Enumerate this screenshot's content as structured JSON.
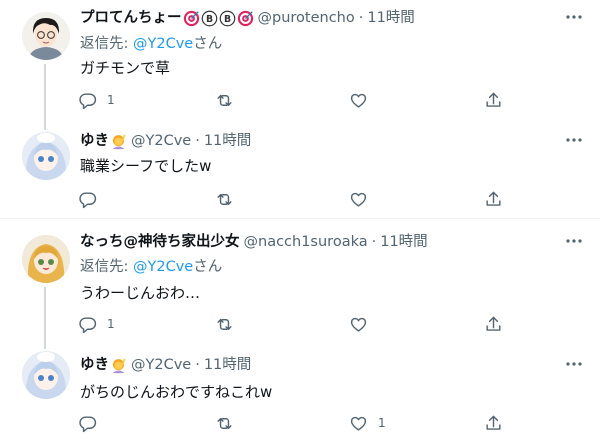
{
  "tweets": [
    {
      "name": "プロてんちょー",
      "handle": "@purotencho",
      "time": "11時間",
      "reply_prefix": "返信先: ",
      "reply_mention": "@Y2Cve",
      "reply_suffix": "さん",
      "text": "ガチモンで草",
      "replies": "1",
      "retweets": "",
      "likes": ""
    },
    {
      "name": "ゆき",
      "handle": "@Y2Cve",
      "time": "11時間",
      "text": "職業シーフでしたw",
      "replies": "",
      "retweets": "",
      "likes": ""
    },
    {
      "name": "なっち@神待ち家出少女",
      "handle": "@nacch1suroaka",
      "time": "11時間",
      "reply_prefix": "返信先: ",
      "reply_mention": "@Y2Cve",
      "reply_suffix": "さん",
      "text": "うわーじんおわ…",
      "replies": "1",
      "retweets": "",
      "likes": ""
    },
    {
      "name": "ゆき",
      "handle": "@Y2Cve",
      "time": "11時間",
      "text": "がちのじんおわですねこれw",
      "replies": "",
      "retweets": "",
      "likes": "1"
    }
  ],
  "separator": "·",
  "colors": {
    "accent": "#1d9bf0",
    "secondary_text": "#536471",
    "thread_line": "#cfd9de"
  },
  "icons": [
    "more-icon",
    "reply-icon",
    "retweet-icon",
    "like-icon",
    "share-icon",
    "target-emoji",
    "circled-b-emoji",
    "woman-raising-hand-emoji"
  ]
}
